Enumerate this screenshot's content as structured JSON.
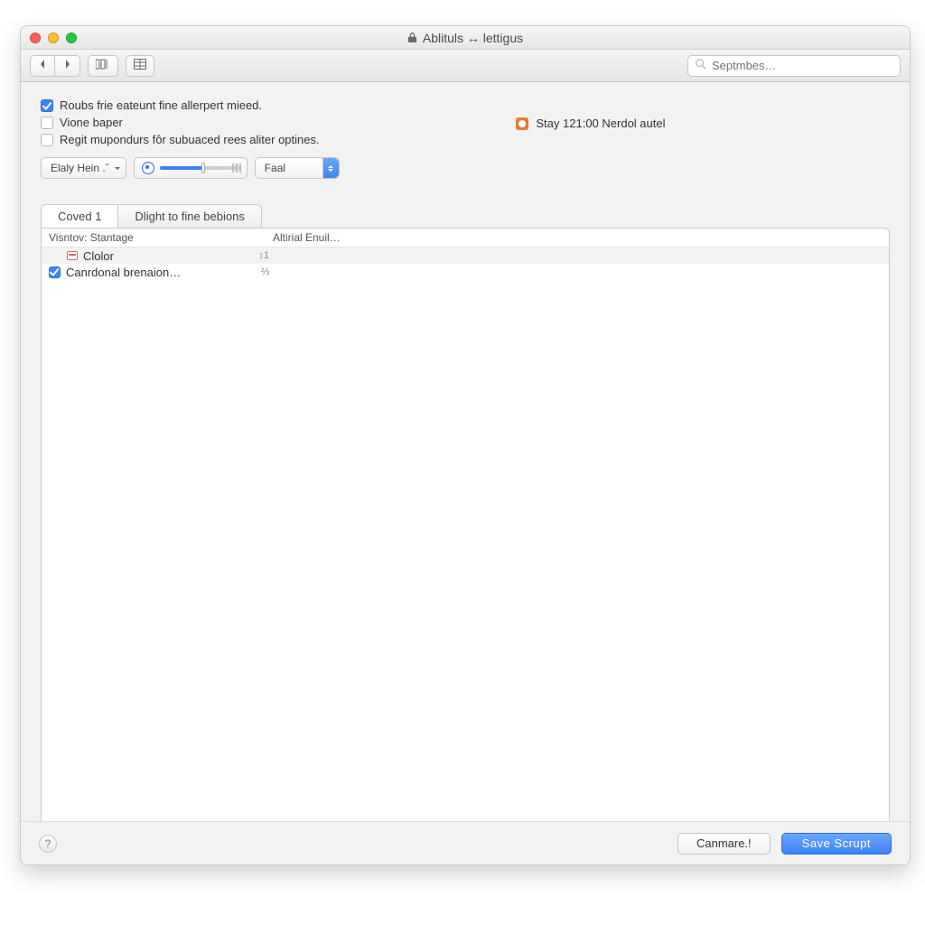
{
  "title": "Ablituls ↔ lettigus",
  "search": {
    "placeholder": "Septmbes…"
  },
  "checks": [
    {
      "checked": true,
      "label": "Roubs frie eateunt fine allerpert mieed."
    },
    {
      "checked": false,
      "label": "Vione baper"
    },
    {
      "checked": false,
      "label": "Regit mupondurs fôr subuaced rees aliter optines."
    }
  ],
  "stay": {
    "label": "Stay 121:00 Nerdol autel"
  },
  "controls": {
    "left_dropdown": "Elaly Hein .ˇ",
    "right_dropdown": "Faal"
  },
  "tabs": [
    {
      "label": "Coved 1",
      "active": true
    },
    {
      "label": "Dlight to fine bebions",
      "active": false
    }
  ],
  "columns": {
    "c1": "Visntov: Stantage",
    "c2": "Altirial Enuil…"
  },
  "rows": [
    {
      "checked": null,
      "icon": "color-swatch",
      "label": "Clolor",
      "flag": "↕1"
    },
    {
      "checked": true,
      "icon": null,
      "label": "Canrdonal brenaion…",
      "flag": "⅔"
    }
  ],
  "buttons": {
    "cancel": "Canmare.!",
    "save": "Save Scrupt"
  },
  "help": "?"
}
